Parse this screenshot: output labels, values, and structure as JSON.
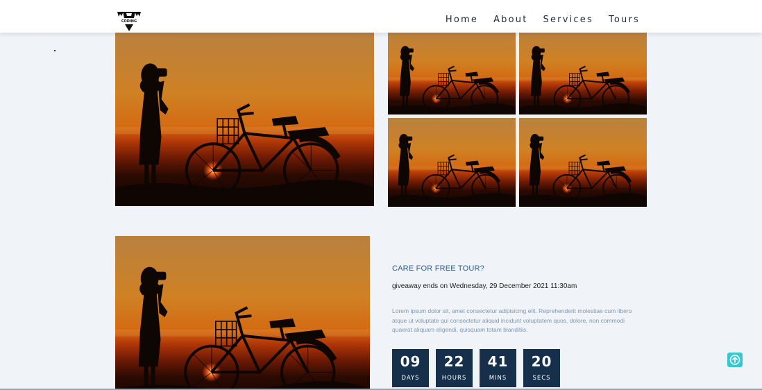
{
  "nav": {
    "logo_text": "CODING",
    "links": [
      "Home",
      "About",
      "Services",
      "Tours"
    ]
  },
  "images": {
    "icon": "photo-sunset-girl-bicycle-icon",
    "colors": {
      "sky_top": "#c98a3e",
      "sky_mid": "#d9771c",
      "horizon": "#8a1f05",
      "sun": "#ff5a18",
      "silhouette": "#0d0603"
    }
  },
  "tour_card": {
    "heading": "CARE FOR FREE TOUR?",
    "subheading": "giveaway ends on Wednesday, 29 December 2021 11:30am",
    "body": "Lorem ipsum dolor sit, amet consectetur adipisicing elit. Reprehenderit molestiae cum libero atque ut voluptate qui consectetur aliquid incidunt voluptatem quos, dolore, non commodi quaerat aliquam eligendi, quisquam totam blanditiis.",
    "countdown": [
      {
        "value": "09",
        "label": "DAYS"
      },
      {
        "value": "22",
        "label": "HOURS"
      },
      {
        "value": "41",
        "label": "MINS"
      },
      {
        "value": "20",
        "label": "SECS"
      }
    ]
  },
  "scroll_top": {
    "icon": "arrow-up-icon",
    "color": "#36c7d4"
  }
}
